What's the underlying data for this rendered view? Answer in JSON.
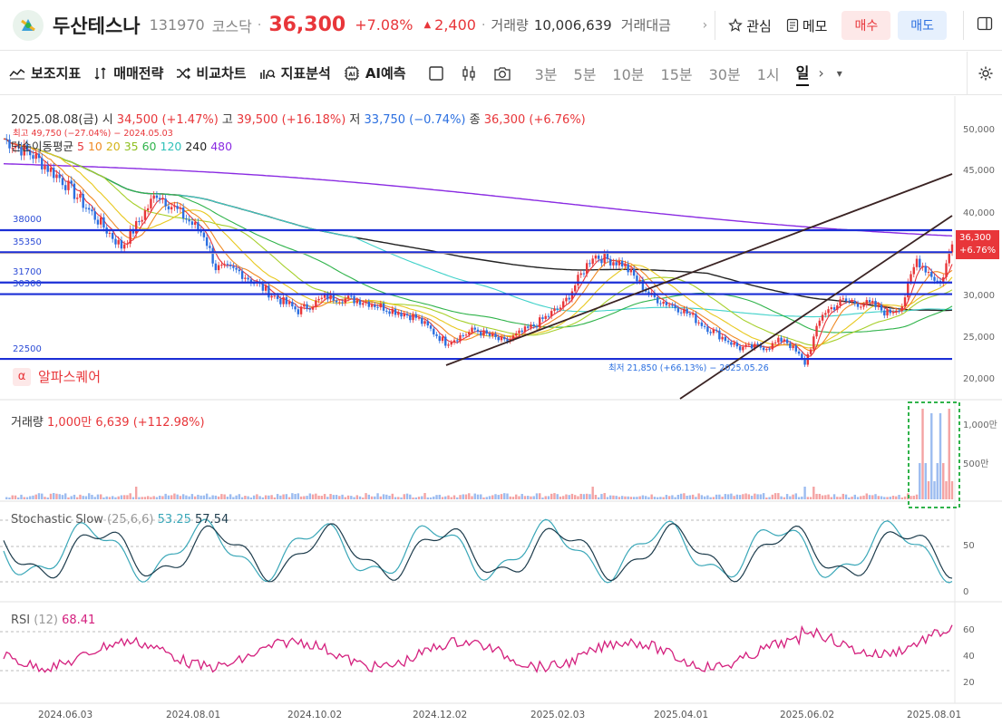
{
  "header": {
    "stock_name": "두산테스나",
    "code": "131970",
    "market": "코스닥",
    "price": "36,300",
    "change_pct": "+7.08%",
    "change_abs": "2,400",
    "volume_label": "거래량",
    "volume": "10,006,639",
    "amount_label": "거래대금",
    "watch_label": "관심",
    "memo_label": "메모",
    "buy_label": "매수",
    "sell_label": "매도"
  },
  "toolbar": {
    "indicator_label": "보조지표",
    "strategy_label": "매매전략",
    "compare_label": "비교차트",
    "analysis_label": "지표분석",
    "ai_label": "AI예측",
    "timeframes": [
      "3분",
      "5분",
      "10분",
      "15분",
      "30분",
      "1시",
      "일"
    ],
    "active_timeframe": "일"
  },
  "price_panel": {
    "date": "2025.08.08(금)",
    "open_label": "시",
    "open": "34,500",
    "open_pct": "(+1.47%)",
    "high_label": "고",
    "high": "39,500",
    "high_pct": "(+16.18%)",
    "low_label": "저",
    "low": "33,750",
    "low_pct": "(−0.74%)",
    "close_label": "종",
    "close": "36,300",
    "close_pct": "(+6.76%)",
    "ma_label": "단순이동평균",
    "ma_periods": [
      "5",
      "10",
      "20",
      "35",
      "60",
      "120",
      "240",
      "480"
    ],
    "ma_colors": [
      "#e8363a",
      "#f08a24",
      "#e8c81e",
      "#a6cf2a",
      "#2fb34a",
      "#3fd1c9",
      "#222222",
      "#8a2be2"
    ],
    "high_note": "최고 49,750 (−27.04%) − 2024.05.03",
    "low_note": "최저 21,850 (+66.13%) − 2025.05.26",
    "levels": [
      "38000",
      "35350",
      "31700",
      "30300",
      "22500"
    ],
    "y_ticks": [
      "50,000",
      "45,000",
      "40,000",
      "35,000",
      "30,000",
      "25,000",
      "20,000"
    ],
    "current_tag": "36,300",
    "current_tag_pct": "+6.76%",
    "alpha_label": "알파스퀘어",
    "alpha_icon": "α"
  },
  "volume_panel": {
    "label": "거래량",
    "unit": "1,000만",
    "value": "6,639",
    "pct": "(+112.98%)",
    "ticks": [
      "1,000만",
      "500만"
    ]
  },
  "stoch_panel": {
    "label": "Stochastic Slow",
    "params": "(25,6,6)",
    "v1": "53.25",
    "v2": "57.54",
    "ticks": [
      "50",
      "0"
    ]
  },
  "rsi_panel": {
    "label": "RSI",
    "params": "(12)",
    "value": "68.41",
    "ticks": [
      "60",
      "40",
      "20"
    ]
  },
  "dates": [
    "2024.06.03",
    "2024.08.01",
    "2024.10.02",
    "2024.12.02",
    "2025.02.03",
    "2025.04.01",
    "2025.06.02",
    "2025.08.01"
  ],
  "colors": {
    "up": "#e8363a",
    "down": "#2b6fe0",
    "level": "#1b2fd6",
    "stoch1": "#3aa7b8",
    "stoch2": "#1d3c4c",
    "rsi": "#d4207e"
  }
}
